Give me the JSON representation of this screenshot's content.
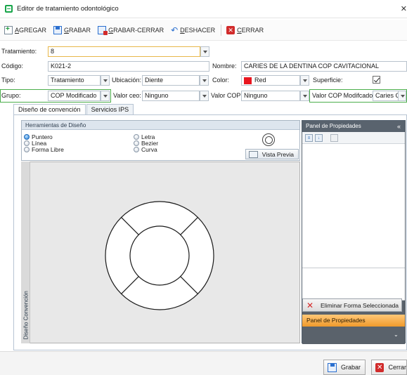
{
  "window": {
    "title": "Editor de tratamiento odontológico"
  },
  "toolbar": {
    "add_label": "AGREGAR",
    "save_label": "GRABAR",
    "save_close_label": "GRABAR-CERRAR",
    "undo_label": "DESHACER",
    "close_label": "CERRAR"
  },
  "form": {
    "tratamiento_label": "Tratamiento:",
    "tratamiento_value": "8",
    "codigo_label": "Código:",
    "codigo_value": "K021-2",
    "nombre_label": "Nombre:",
    "nombre_value": "CARIES DE LA DENTINA COP CAVITACIONAL",
    "tipo_label": "Tipo:",
    "tipo_value": "Tratamiento",
    "ubicacion_label": "Ubicación:",
    "ubicacion_value": "Diente",
    "color_label": "Color:",
    "color_value": "Red",
    "color_hex": "#e8161f",
    "superficie_label": "Superficie:",
    "superficie_checked": true,
    "grupo_label": "Grupo:",
    "grupo_value": "COP Modificado",
    "valor_ceo_label": "Valor ceo:",
    "valor_ceo_value": "Ninguno",
    "valor_cop_label": "Valor COP:",
    "valor_cop_value": "Ninguno",
    "valor_cop_mod_label": "Valor COP Modifcado:",
    "valor_cop_mod_value": "Caries C"
  },
  "tabs": [
    {
      "label": "Diseño de convención",
      "active": true
    },
    {
      "label": "Servicios IPS",
      "active": false
    }
  ],
  "design_tools": {
    "title": "Herramientas de Diseño",
    "options": [
      "Puntero",
      "Línea",
      "Forma Libre",
      "Letra",
      "Bezier",
      "Curva"
    ],
    "selected": "Puntero",
    "preview_label": "Vista Previa"
  },
  "canvas": {
    "side_label": "Diseño Convención"
  },
  "properties": {
    "title": "Panel de Propiedades",
    "collapse_glyph": "«",
    "remove_shape_label": "Eliminar Forma Seleccionada",
    "active_section": "Panel de Propiedades"
  },
  "footer": {
    "save_label": "Grabar",
    "close_label": "Cerrar"
  },
  "icons": {
    "close_window": "close-icon",
    "add": "add-icon",
    "save": "save-icon",
    "undo": "undo-icon",
    "close": "close-icon"
  },
  "colors": {
    "accent_green": "#4cae4c",
    "panel_dark": "#59636e",
    "active_orange": "#f09a2c",
    "danger": "#d12b2b"
  }
}
